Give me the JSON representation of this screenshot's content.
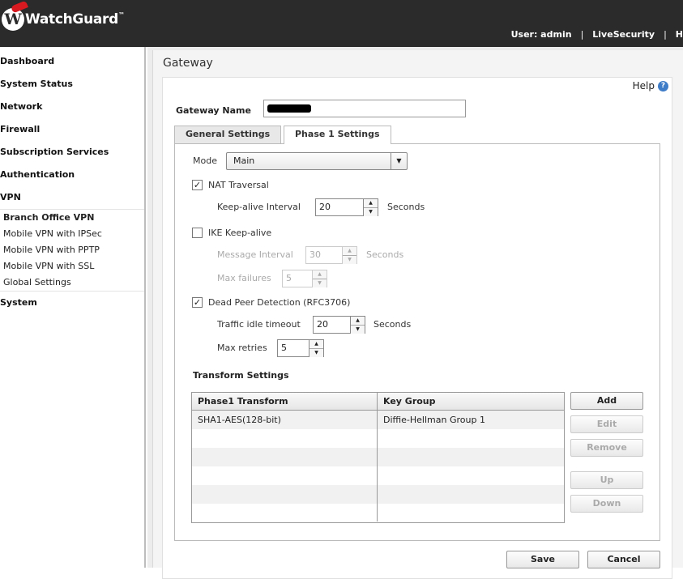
{
  "header": {
    "logo_text": "WatchGuard",
    "user_label": "User: admin",
    "separator": "|",
    "live_security": "LiveSecurity",
    "help_link_partial": "H"
  },
  "sidebar": {
    "items": [
      {
        "label": "Dashboard"
      },
      {
        "label": "System Status"
      },
      {
        "label": "Network"
      },
      {
        "label": "Firewall"
      },
      {
        "label": "Subscription Services"
      },
      {
        "label": "Authentication"
      },
      {
        "label": "VPN"
      }
    ],
    "vpn_subitems": [
      {
        "label": "Branch Office VPN",
        "active": true
      },
      {
        "label": "Mobile VPN with IPSec"
      },
      {
        "label": "Mobile VPN with PPTP"
      },
      {
        "label": "Mobile VPN with SSL"
      },
      {
        "label": "Global Settings"
      }
    ],
    "last_item": "System"
  },
  "page": {
    "title": "Gateway",
    "help": "Help",
    "gateway_name_label": "Gateway Name",
    "gateway_name_value": ""
  },
  "tabs": [
    {
      "label": "General Settings",
      "active": false
    },
    {
      "label": "Phase 1 Settings",
      "active": true
    }
  ],
  "phase1": {
    "mode_label": "Mode",
    "mode_value": "Main",
    "nat_traversal_label": "NAT Traversal",
    "nat_traversal_checked": true,
    "keepalive_interval_label": "Keep-alive Interval",
    "keepalive_interval_value": "20",
    "seconds": "Seconds",
    "ike_keepalive_label": "IKE Keep-alive",
    "ike_keepalive_checked": false,
    "message_interval_label": "Message Interval",
    "message_interval_value": "30",
    "max_failures_label": "Max failures",
    "max_failures_value": "5",
    "dpd_label": "Dead Peer Detection (RFC3706)",
    "dpd_checked": true,
    "traffic_idle_label": "Traffic idle timeout",
    "traffic_idle_value": "20",
    "max_retries_label": "Max retries",
    "max_retries_value": "5",
    "transform_settings_label": "Transform Settings"
  },
  "transform_table": {
    "columns": [
      "Phase1 Transform",
      "Key Group"
    ],
    "rows": [
      [
        "SHA1-AES(128-bit)",
        "Diffie-Hellman Group 1"
      ],
      [
        "",
        ""
      ],
      [
        "",
        ""
      ],
      [
        "",
        ""
      ],
      [
        "",
        ""
      ],
      [
        "",
        ""
      ]
    ]
  },
  "buttons": {
    "add": "Add",
    "edit": "Edit",
    "remove": "Remove",
    "up": "Up",
    "down": "Down",
    "save": "Save",
    "cancel": "Cancel"
  }
}
